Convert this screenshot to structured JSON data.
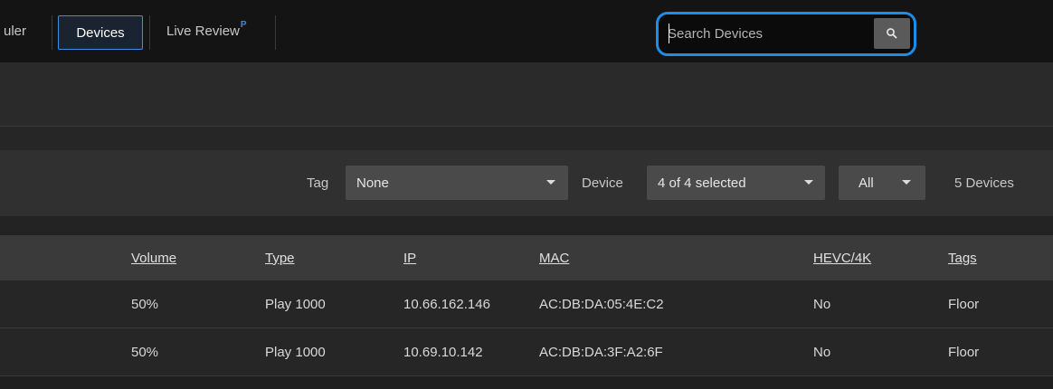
{
  "nav": {
    "scheduler_partial": "uler",
    "devices": "Devices",
    "live_review": "Live Review",
    "live_review_badge": "P"
  },
  "search": {
    "placeholder": "Search Devices",
    "value": ""
  },
  "filters": {
    "tag_label": "Tag",
    "tag_value": "None",
    "device_label": "Device",
    "device_value": "4 of 4 selected",
    "status_value": "All",
    "device_count": "5 Devices"
  },
  "table": {
    "columns": [
      "Volume",
      "Type",
      "IP",
      "MAC",
      "HEVC/4K",
      "Tags"
    ],
    "rows": [
      [
        "50%",
        "Play 1000",
        "10.66.162.146",
        "AC:DB:DA:05:4E:C2",
        "No",
        "Floor"
      ],
      [
        "50%",
        "Play 1000",
        "10.69.10.142",
        "AC:DB:DA:3F:A2:6F",
        "No",
        "Floor"
      ]
    ]
  },
  "colors": {
    "accent": "#1f8ce6",
    "topbar_bg": "#141414",
    "header_bg": "#3a3a3a",
    "row_bg": "#262626"
  }
}
